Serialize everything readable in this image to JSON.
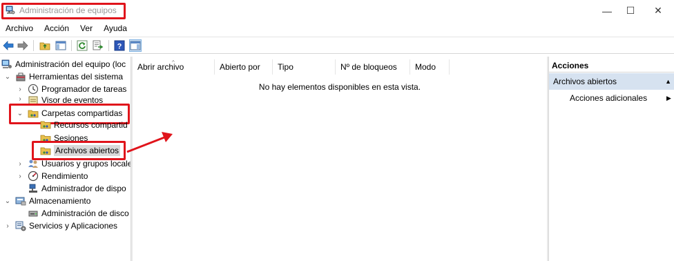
{
  "window": {
    "title": "Administración de equipos",
    "minimize_glyph": "—",
    "maximize_glyph": "☐",
    "close_glyph": "✕"
  },
  "menu": [
    "Archivo",
    "Acción",
    "Ver",
    "Ayuda"
  ],
  "toolbar": {
    "icons": [
      "back-arrow-icon",
      "forward-arrow-icon",
      "up-folder-icon",
      "show-hide-tree-icon",
      "refresh-icon",
      "export-list-icon",
      "help-icon",
      "show-hide-action-pane-icon"
    ]
  },
  "tree": {
    "root": "Administración del equipo (loc",
    "system_tools": "Herramientas del sistema",
    "task_scheduler": "Programador de tareas",
    "event_viewer": "Visor de eventos",
    "shared_folders": "Carpetas compartidas",
    "shares": "Recursos compartid",
    "sessions": "Sesiones",
    "open_files": "Archivos abiertos",
    "local_users": "Usuarios y grupos locale",
    "performance": "Rendimiento",
    "device_manager": "Administrador de dispo",
    "storage": "Almacenamiento",
    "disk_management": "Administración de disco",
    "services_apps": "Servicios y Aplicaciones"
  },
  "list": {
    "columns": [
      "Abrir archivo",
      "Abierto por",
      "Tipo",
      "Nº de bloqueos",
      "Modo"
    ],
    "empty_message": "No hay elementos disponibles en esta vista."
  },
  "actions": {
    "header": "Acciones",
    "group": "Archivos abiertos",
    "item": "Acciones adicionales"
  },
  "colors": {
    "highlight": "#e0141b",
    "action_group_bg": "#d6e2f0",
    "selection_bg": "#d9d9d9"
  }
}
